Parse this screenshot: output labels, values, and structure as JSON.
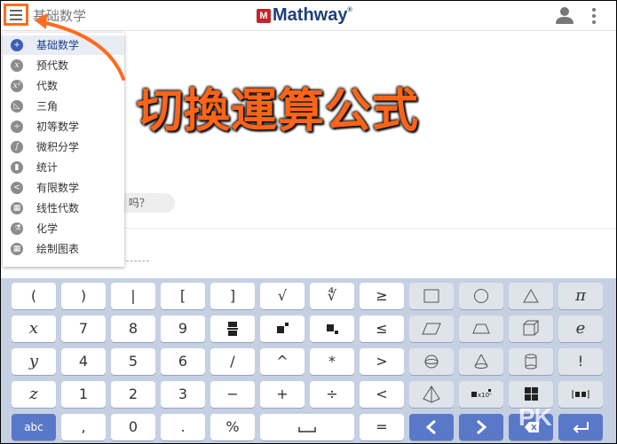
{
  "header": {
    "subject_title": "基础数学",
    "logo_badge": "M",
    "logo_text": "Mathway",
    "logo_tm": "®",
    "menu_icon": "hamburger-icon",
    "user_icon": "user-icon",
    "more_icon": "more-vertical-icon"
  },
  "overlay": {
    "text": "切換運算公式",
    "color": "#ff6418"
  },
  "chat": {
    "bubble_text": "么 吗？"
  },
  "subject_menu": {
    "items": [
      {
        "label": "基础数学",
        "icon": "+",
        "selected": true
      },
      {
        "label": "预代数",
        "icon": "x"
      },
      {
        "label": "代数",
        "icon": "x²"
      },
      {
        "label": "三角",
        "icon": "◺"
      },
      {
        "label": "初等数学",
        "icon": "÷"
      },
      {
        "label": "微积分学",
        "icon": "∫"
      },
      {
        "label": "统计",
        "icon": "▮"
      },
      {
        "label": "有限数学",
        "icon": "<"
      },
      {
        "label": "线性代数",
        "icon": "▦"
      },
      {
        "label": "化学",
        "icon": "⚗"
      },
      {
        "label": "绘制图表",
        "icon": "▦"
      }
    ]
  },
  "keyboard": {
    "rows": [
      [
        "(",
        ")",
        "|",
        "[",
        "]",
        "√",
        "∜",
        "≥",
        "square-icon",
        "circle-icon",
        "triangle-icon",
        "π"
      ],
      [
        "x",
        "7",
        "8",
        "9",
        "fraction-icon",
        "superscript-icon",
        "subscript-icon",
        "≤",
        "parallelogram-icon",
        "trapezoid-icon",
        "cube-icon",
        "e"
      ],
      [
        "y",
        "4",
        "5",
        "6",
        "/",
        "^",
        "*",
        ">",
        "sphere-icon",
        "cone-icon",
        "cylinder-icon",
        "!"
      ],
      [
        "z",
        "1",
        "2",
        "3",
        "−",
        "+",
        "÷",
        "<",
        "pyramid-icon",
        "scientific-notation-icon",
        "matrix-icon",
        "vector-icon"
      ],
      [
        "abc",
        ",",
        "0",
        ".",
        "%",
        "space-icon",
        "=",
        "left-arrow-icon",
        "right-arrow-icon",
        "enter-icon"
      ]
    ],
    "sci_label": "x10ⁿ"
  },
  "watermark": "PK",
  "colors": {
    "accent_orange": "#ff6b1f",
    "keyboard_bg": "#c6d0e3",
    "blue_key": "#5a78c8",
    "brand_navy": "#1f3f7a"
  }
}
